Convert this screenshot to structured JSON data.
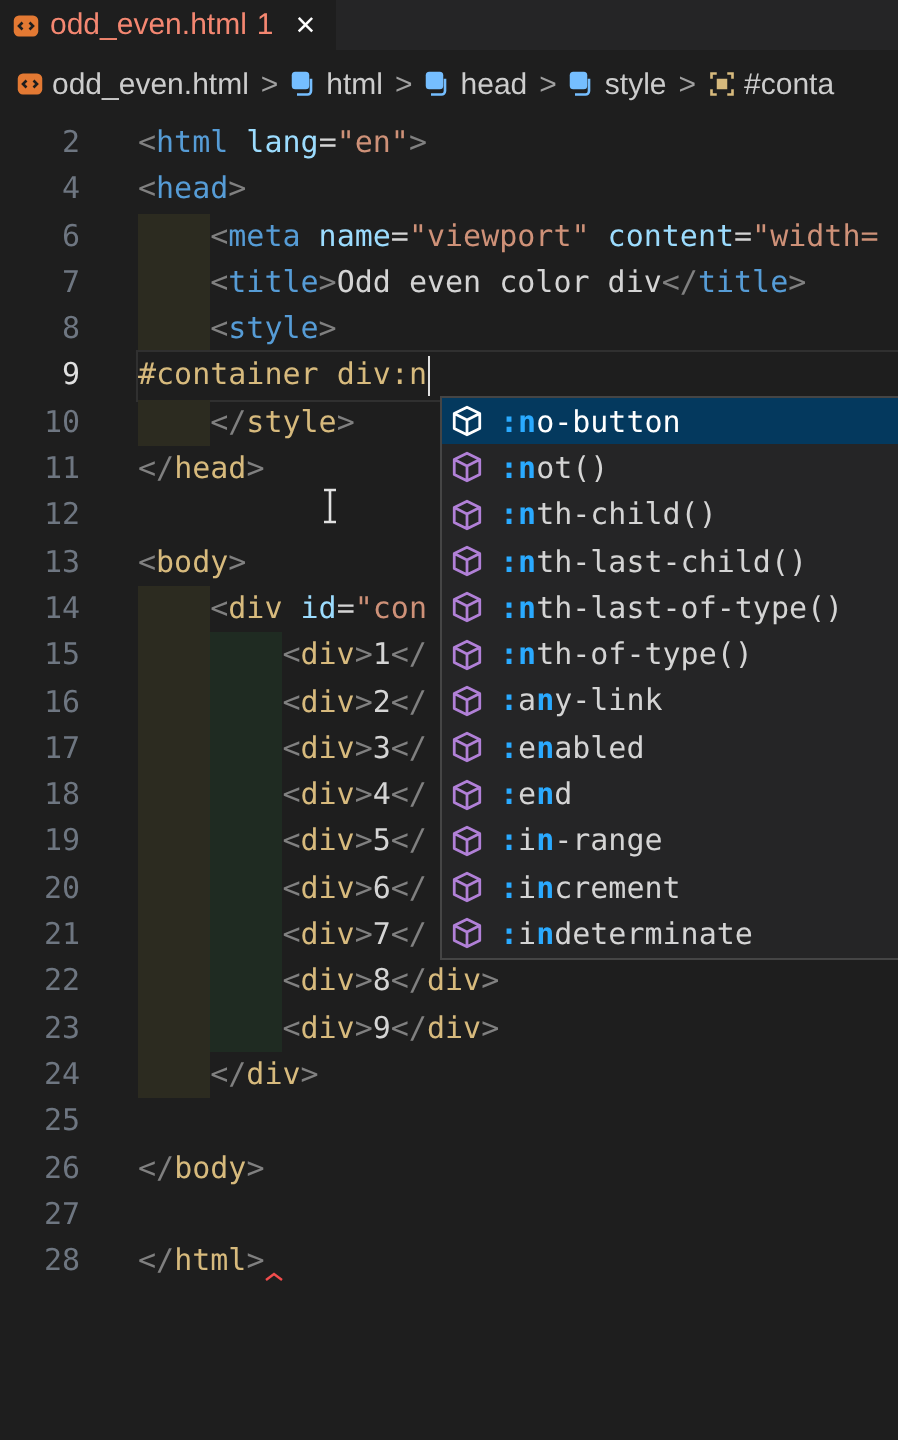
{
  "tab": {
    "file": "odd_even.html",
    "problems": "1",
    "close": "×",
    "selected": true
  },
  "breadcrumb": [
    {
      "kind": "file",
      "text": "odd_even.html"
    },
    {
      "kind": "element",
      "text": "html"
    },
    {
      "kind": "element",
      "text": "head"
    },
    {
      "kind": "element",
      "text": "style"
    },
    {
      "kind": "selector",
      "text": "#conta"
    }
  ],
  "breadcrumb_separator": ">",
  "lines": [
    {
      "number": "2",
      "tokens": [
        {
          "kind": "punct",
          "text": "<"
        },
        {
          "kind": "tag",
          "text": "html"
        },
        {
          "kind": "attr",
          "text": " lang"
        },
        {
          "kind": "text",
          "text": "="
        },
        {
          "kind": "value",
          "text": "\"en\""
        },
        {
          "kind": "punct",
          "text": ">"
        }
      ]
    },
    {
      "number": "4",
      "tokens": [
        {
          "kind": "punct",
          "text": "<"
        },
        {
          "kind": "tag",
          "text": "head"
        },
        {
          "kind": "punct",
          "text": ">"
        }
      ]
    },
    {
      "number": "6",
      "guides": [
        {
          "kind": "outer"
        }
      ],
      "tokens": [
        {
          "kind": "punct",
          "text": "<"
        },
        {
          "kind": "tag",
          "text": "meta"
        },
        {
          "kind": "attr",
          "text": " name"
        },
        {
          "kind": "text",
          "text": "="
        },
        {
          "kind": "value",
          "text": "\"viewport\""
        },
        {
          "kind": "attr",
          "text": " content"
        },
        {
          "kind": "text",
          "text": "="
        },
        {
          "kind": "value",
          "text": "\"width="
        }
      ]
    },
    {
      "number": "7",
      "guides": [
        {
          "kind": "outer"
        }
      ],
      "tokens": [
        {
          "kind": "punct",
          "text": "<"
        },
        {
          "kind": "tag",
          "text": "title"
        },
        {
          "kind": "punct",
          "text": ">"
        },
        {
          "kind": "text",
          "text": "Odd even color div"
        },
        {
          "kind": "punct",
          "text": "</"
        },
        {
          "kind": "tag",
          "text": "title"
        },
        {
          "kind": "punct",
          "text": ">"
        }
      ]
    },
    {
      "number": "8",
      "guides": [
        {
          "kind": "outer"
        }
      ],
      "tokens": [
        {
          "kind": "punct",
          "text": "<"
        },
        {
          "kind": "tag",
          "text": "style"
        },
        {
          "kind": "punct",
          "text": ">"
        }
      ]
    },
    {
      "number": "9",
      "current": true,
      "cursor": true,
      "tokens": [
        {
          "kind": "selector",
          "text": "#container div:n"
        }
      ]
    },
    {
      "number": "10",
      "guides": [
        {
          "kind": "outer"
        }
      ],
      "tokens": [
        {
          "kind": "punct",
          "text": "</"
        },
        {
          "kind": "tag2",
          "text": "style"
        },
        {
          "kind": "punct",
          "text": ">"
        }
      ]
    },
    {
      "number": "11",
      "tokens": [
        {
          "kind": "punct",
          "text": "</"
        },
        {
          "kind": "tag2",
          "text": "head"
        },
        {
          "kind": "punct",
          "text": ">"
        }
      ]
    },
    {
      "number": "12"
    },
    {
      "number": "13",
      "tokens": [
        {
          "kind": "punct",
          "text": "<"
        },
        {
          "kind": "tag2",
          "text": "body"
        },
        {
          "kind": "punct",
          "text": ">"
        }
      ]
    },
    {
      "number": "14",
      "guides": [
        {
          "kind": "outer"
        }
      ],
      "tokens": [
        {
          "kind": "punct",
          "text": "<"
        },
        {
          "kind": "tag2",
          "text": "div"
        },
        {
          "kind": "attr",
          "text": " id"
        },
        {
          "kind": "text",
          "text": "="
        },
        {
          "kind": "value",
          "text": "\"con"
        }
      ]
    },
    {
      "number": "15",
      "guides": [
        {
          "kind": "outer"
        },
        {
          "kind": "inner"
        }
      ],
      "tokens": [
        {
          "kind": "punct",
          "text": "<"
        },
        {
          "kind": "tag2",
          "text": "div"
        },
        {
          "kind": "punct",
          "text": ">"
        },
        {
          "kind": "text",
          "text": "1"
        },
        {
          "kind": "punct",
          "text": "</"
        }
      ]
    },
    {
      "number": "16",
      "guides": [
        {
          "kind": "outer"
        },
        {
          "kind": "inner"
        }
      ],
      "tokens": [
        {
          "kind": "punct",
          "text": "<"
        },
        {
          "kind": "tag2",
          "text": "div"
        },
        {
          "kind": "punct",
          "text": ">"
        },
        {
          "kind": "text",
          "text": "2"
        },
        {
          "kind": "punct",
          "text": "</"
        }
      ]
    },
    {
      "number": "17",
      "guides": [
        {
          "kind": "outer"
        },
        {
          "kind": "inner"
        }
      ],
      "tokens": [
        {
          "kind": "punct",
          "text": "<"
        },
        {
          "kind": "tag2",
          "text": "div"
        },
        {
          "kind": "punct",
          "text": ">"
        },
        {
          "kind": "text",
          "text": "3"
        },
        {
          "kind": "punct",
          "text": "</"
        }
      ]
    },
    {
      "number": "18",
      "guides": [
        {
          "kind": "outer"
        },
        {
          "kind": "inner"
        }
      ],
      "tokens": [
        {
          "kind": "punct",
          "text": "<"
        },
        {
          "kind": "tag2",
          "text": "div"
        },
        {
          "kind": "punct",
          "text": ">"
        },
        {
          "kind": "text",
          "text": "4"
        },
        {
          "kind": "punct",
          "text": "</"
        }
      ]
    },
    {
      "number": "19",
      "guides": [
        {
          "kind": "outer"
        },
        {
          "kind": "inner"
        }
      ],
      "tokens": [
        {
          "kind": "punct",
          "text": "<"
        },
        {
          "kind": "tag2",
          "text": "div"
        },
        {
          "kind": "punct",
          "text": ">"
        },
        {
          "kind": "text",
          "text": "5"
        },
        {
          "kind": "punct",
          "text": "</"
        }
      ]
    },
    {
      "number": "20",
      "guides": [
        {
          "kind": "outer"
        },
        {
          "kind": "inner"
        }
      ],
      "tokens": [
        {
          "kind": "punct",
          "text": "<"
        },
        {
          "kind": "tag2",
          "text": "div"
        },
        {
          "kind": "punct",
          "text": ">"
        },
        {
          "kind": "text",
          "text": "6"
        },
        {
          "kind": "punct",
          "text": "</"
        }
      ]
    },
    {
      "number": "21",
      "guides": [
        {
          "kind": "outer"
        },
        {
          "kind": "inner"
        }
      ],
      "tokens": [
        {
          "kind": "punct",
          "text": "<"
        },
        {
          "kind": "tag2",
          "text": "div"
        },
        {
          "kind": "punct",
          "text": ">"
        },
        {
          "kind": "text",
          "text": "7"
        },
        {
          "kind": "punct",
          "text": "</"
        }
      ]
    },
    {
      "number": "22",
      "guides": [
        {
          "kind": "outer"
        },
        {
          "kind": "inner"
        }
      ],
      "tokens": [
        {
          "kind": "punct",
          "text": "<"
        },
        {
          "kind": "tag2",
          "text": "div"
        },
        {
          "kind": "punct",
          "text": ">"
        },
        {
          "kind": "text",
          "text": "8"
        },
        {
          "kind": "punct",
          "text": "</"
        },
        {
          "kind": "tag2",
          "text": "div"
        },
        {
          "kind": "punct",
          "text": ">"
        }
      ]
    },
    {
      "number": "23",
      "guides": [
        {
          "kind": "outer"
        },
        {
          "kind": "inner"
        }
      ],
      "tokens": [
        {
          "kind": "punct",
          "text": "<"
        },
        {
          "kind": "tag2",
          "text": "div"
        },
        {
          "kind": "punct",
          "text": ">"
        },
        {
          "kind": "text",
          "text": "9"
        },
        {
          "kind": "punct",
          "text": "</"
        },
        {
          "kind": "tag2",
          "text": "div"
        },
        {
          "kind": "punct",
          "text": ">"
        }
      ]
    },
    {
      "number": "24",
      "guides": [
        {
          "kind": "outer"
        }
      ],
      "tokens": [
        {
          "kind": "punct",
          "text": "</"
        },
        {
          "kind": "tag2",
          "text": "div"
        },
        {
          "kind": "punct",
          "text": ">"
        }
      ]
    },
    {
      "number": "25"
    },
    {
      "number": "26",
      "tokens": [
        {
          "kind": "punct",
          "text": "</"
        },
        {
          "kind": "tag2",
          "text": "body"
        },
        {
          "kind": "punct",
          "text": ">"
        }
      ]
    },
    {
      "number": "27"
    },
    {
      "number": "28",
      "squiggle": true,
      "tokens": [
        {
          "kind": "punct",
          "text": "</"
        },
        {
          "kind": "tag2",
          "text": "html"
        },
        {
          "kind": "punct",
          "text": ">"
        }
      ]
    }
  ],
  "suggestions": [
    {
      "selected": true,
      "segments": [
        {
          "text": ":n",
          "match": true
        },
        {
          "text": "o-button",
          "match": false
        }
      ]
    },
    {
      "selected": false,
      "segments": [
        {
          "text": ":n",
          "match": true
        },
        {
          "text": "ot()",
          "match": false
        }
      ]
    },
    {
      "selected": false,
      "segments": [
        {
          "text": ":n",
          "match": true
        },
        {
          "text": "th-child()",
          "match": false
        }
      ]
    },
    {
      "selected": false,
      "segments": [
        {
          "text": ":n",
          "match": true
        },
        {
          "text": "th-last-child()",
          "match": false
        }
      ]
    },
    {
      "selected": false,
      "segments": [
        {
          "text": ":n",
          "match": true
        },
        {
          "text": "th-last-of-type()",
          "match": false
        }
      ]
    },
    {
      "selected": false,
      "segments": [
        {
          "text": ":n",
          "match": true
        },
        {
          "text": "th-of-type()",
          "match": false
        }
      ]
    },
    {
      "selected": false,
      "segments": [
        {
          "text": ":",
          "match": true
        },
        {
          "text": "a",
          "match": false
        },
        {
          "text": "n",
          "match": true
        },
        {
          "text": "y-link",
          "match": false
        }
      ]
    },
    {
      "selected": false,
      "segments": [
        {
          "text": ":",
          "match": true
        },
        {
          "text": "e",
          "match": false
        },
        {
          "text": "n",
          "match": true
        },
        {
          "text": "abled",
          "match": false
        }
      ]
    },
    {
      "selected": false,
      "segments": [
        {
          "text": ":",
          "match": true
        },
        {
          "text": "e",
          "match": false
        },
        {
          "text": "n",
          "match": true
        },
        {
          "text": "d",
          "match": false
        }
      ]
    },
    {
      "selected": false,
      "segments": [
        {
          "text": ":",
          "match": true
        },
        {
          "text": "i",
          "match": false
        },
        {
          "text": "n",
          "match": true
        },
        {
          "text": "-range",
          "match": false
        }
      ]
    },
    {
      "selected": false,
      "segments": [
        {
          "text": ":",
          "match": true
        },
        {
          "text": "i",
          "match": false
        },
        {
          "text": "n",
          "match": true
        },
        {
          "text": "crement",
          "match": false
        }
      ]
    },
    {
      "selected": false,
      "segments": [
        {
          "text": ":",
          "match": true
        },
        {
          "text": "i",
          "match": false
        },
        {
          "text": "n",
          "match": true
        },
        {
          "text": "determinate",
          "match": false
        }
      ]
    }
  ]
}
